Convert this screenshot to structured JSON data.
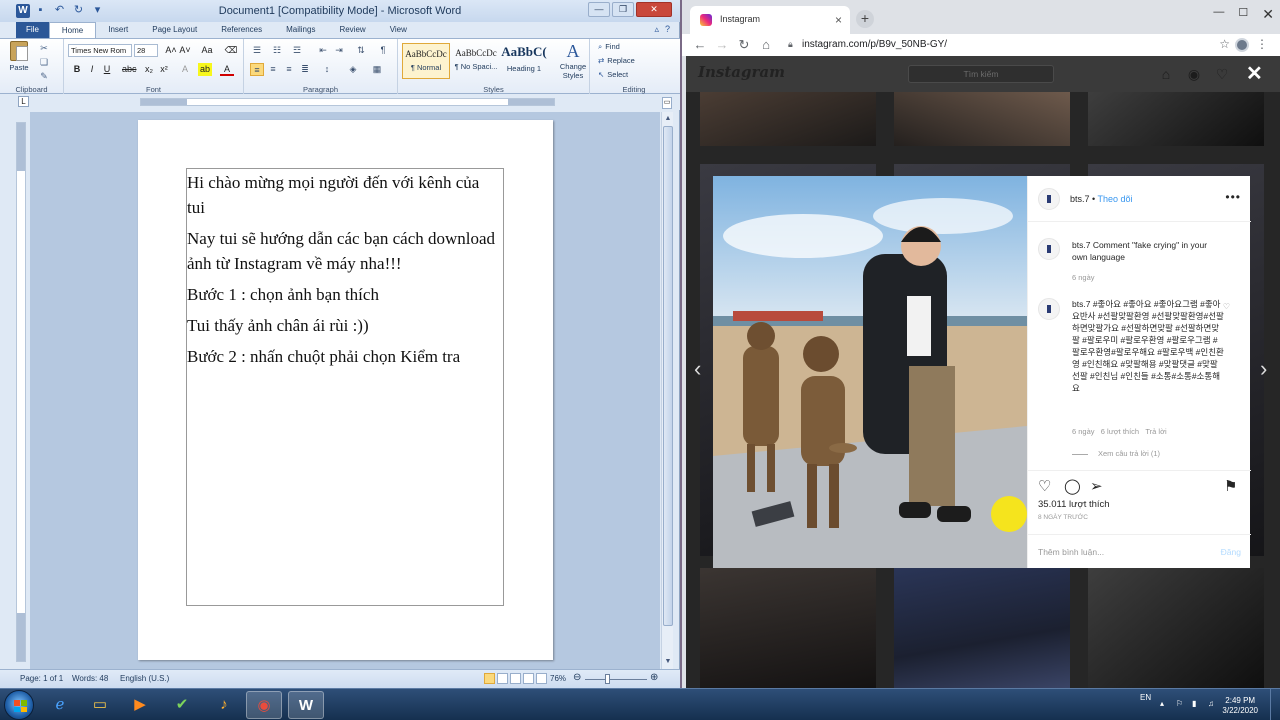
{
  "word": {
    "title": "Document1 [Compatibility Mode] - Microsoft Word",
    "tabs": [
      "File",
      "Home",
      "Insert",
      "Page Layout",
      "References",
      "Mailings",
      "Review",
      "View"
    ],
    "active_tab": "Home",
    "clipboard": {
      "paste_label": "Paste",
      "group_label": "Clipboard"
    },
    "font": {
      "name": "Times New Rom",
      "size": "28",
      "group_label": "Font"
    },
    "paragraph": {
      "group_label": "Paragraph"
    },
    "styles": {
      "group_label": "Styles",
      "items": [
        {
          "sample": "AaBbCcDc",
          "name": "¶ Normal"
        },
        {
          "sample": "AaBbCcDc",
          "name": "¶ No Spaci..."
        },
        {
          "sample": "AaBbC(",
          "name": "Heading 1"
        }
      ],
      "change_styles": "Change Styles"
    },
    "editing": {
      "find": "Find",
      "replace": "Replace",
      "select": "Select",
      "group_label": "Editing"
    },
    "document": {
      "paragraphs": [
        "Hi chào mừng mọi người đến với kênh của tui",
        "Nay tui sẽ hướng dẫn các bạn cách download ảnh từ Instagram về máy nha!!!",
        "Bước 1 : chọn ảnh bạn thích",
        "Tui thấy ảnh chân ái rùi :))",
        "Bước 2 : nhấn chuột phải chọn Kiểm tra"
      ]
    },
    "status": {
      "page": "Page: 1 of 1",
      "words": "Words: 48",
      "language": "English (U.S.)",
      "zoom": "76%"
    }
  },
  "chrome": {
    "tab_title": "Instagram",
    "url": "instagram.com/p/B9v_50NB-GY/",
    "instagram": {
      "logo": "Instagram",
      "search_placeholder": "Tìm kiếm",
      "post": {
        "username": "bts.7",
        "follow": "Theo dõi",
        "caption_user": "bts.7",
        "caption": "Comment \"fake crying\" in your own language",
        "caption_time": "6 ngày",
        "comment_user": "bts.7",
        "comment_text": "#좋아요 #좋아요 #좋아요그램 #좋아요반사 #선팔맞팔환영 #선팔맞팔환영#선팔하면맞팔가요 #선팔하면맞팔 #선팔하면맞팔 #팔로우미 #팔로우환영 #팔로우그램 #팔로우환영#팔로우해요 #팔로우백 #인친환영 #인친해요 #맞팔해용 #맞팔댓글 #맞팔선팔 #인친님 #인친들 #소통#소통#소통해요",
        "comment_time": "6 ngày",
        "comment_likes": "6 lượt thích",
        "reply": "Trả lời",
        "view_replies": "Xem câu trả lời (1)",
        "like_count": "35.011 lượt thích",
        "posted_ago": "8 NGÀY TRƯỚC",
        "comment_placeholder": "Thêm bình luận...",
        "post_button": "Đăng"
      }
    }
  },
  "taskbar": {
    "language": "EN",
    "time": "2:49 PM",
    "date": "3/22/2020"
  },
  "colors": {
    "word_blue": "#2b579a",
    "instagram_link": "#3897f0"
  }
}
